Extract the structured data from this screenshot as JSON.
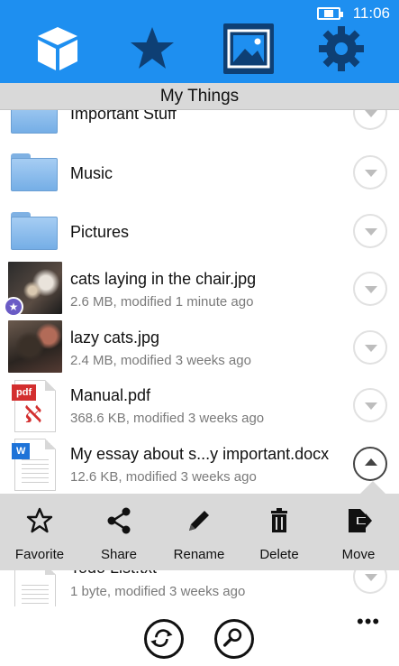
{
  "status": {
    "time": "11:06"
  },
  "header": {
    "icons": [
      "box-icon",
      "star-icon",
      "picture-icon",
      "gear-icon"
    ],
    "selected": "picture-icon",
    "accent": "#1e8ff0",
    "selected_bg": "#0e3f74"
  },
  "title": "My Things",
  "items": [
    {
      "name": "Important Stuff",
      "meta": "",
      "type": "folder"
    },
    {
      "name": "Music",
      "meta": "",
      "type": "folder"
    },
    {
      "name": "Pictures",
      "meta": "",
      "type": "folder"
    },
    {
      "name": "cats laying in the chair.jpg",
      "meta": "2.6 MB, modified 1 minute ago",
      "type": "photo",
      "favorite": true
    },
    {
      "name": "lazy cats.jpg",
      "meta": "2.4 MB, modified 3 weeks ago",
      "type": "photo"
    },
    {
      "name": "Manual.pdf",
      "meta": "368.6 KB, modified 3 weeks ago",
      "type": "pdf",
      "tag": "pdf"
    },
    {
      "name": "My essay about s...y important.docx",
      "meta": "12.6 KB, modified 3 weeks ago",
      "type": "docx",
      "tag": "W",
      "expanded": true
    },
    {
      "name": "Todo List.txt",
      "meta": "1 byte, modified 3 weeks ago",
      "type": "txt"
    }
  ],
  "actions": {
    "favorite": "Favorite",
    "share": "Share",
    "rename": "Rename",
    "delete": "Delete",
    "move": "Move"
  },
  "bottom": {
    "more": "•••"
  }
}
